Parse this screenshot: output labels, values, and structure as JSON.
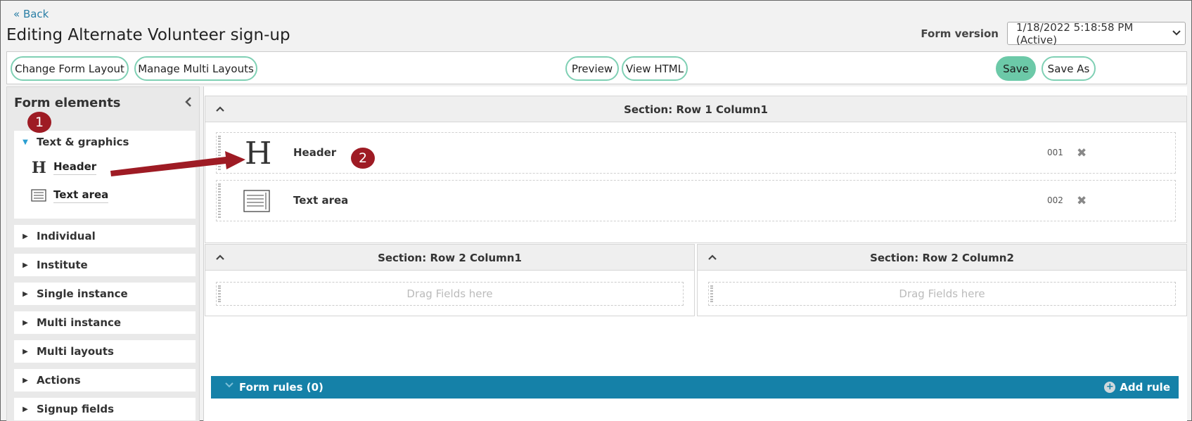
{
  "nav": {
    "back_label": "« Back"
  },
  "page": {
    "title": "Editing Alternate Volunteer sign-up"
  },
  "version": {
    "label": "Form version",
    "selected": "1/18/2022 5:18:58 PM (Active)"
  },
  "toolbar": {
    "change_layout": "Change Form Layout",
    "manage_multi": "Manage Multi Layouts",
    "preview": "Preview",
    "view_html": "View HTML",
    "save": "Save",
    "save_as": "Save As"
  },
  "sidebar": {
    "title": "Form elements",
    "groups": [
      {
        "label": "Text & graphics",
        "expanded": true,
        "items": [
          {
            "label": "Header",
            "icon": "header-icon"
          },
          {
            "label": "Text area",
            "icon": "text-area-icon"
          }
        ]
      },
      {
        "label": "Individual"
      },
      {
        "label": "Institute"
      },
      {
        "label": "Single instance"
      },
      {
        "label": "Multi instance"
      },
      {
        "label": "Multi layouts"
      },
      {
        "label": "Actions"
      },
      {
        "label": "Signup fields"
      }
    ]
  },
  "sections": [
    {
      "title": "Section: Row 1 Column1",
      "fields": [
        {
          "label": "Header",
          "number": "001",
          "icon": "header-icon"
        },
        {
          "label": "Text area",
          "number": "002",
          "icon": "text-area-icon"
        }
      ]
    },
    {
      "title": "Section: Row 2 Column1",
      "placeholder": "Drag Fields here"
    },
    {
      "title": "Section: Row 2 Column2",
      "placeholder": "Drag Fields here"
    }
  ],
  "rules": {
    "title": "Form rules (0)",
    "add_label": "Add rule"
  },
  "annotations": {
    "badge1": "1",
    "badge2": "2"
  },
  "colors": {
    "accent_green": "#6cc9a8",
    "rules_bar": "#1581a8",
    "badge": "#9e1b24"
  }
}
